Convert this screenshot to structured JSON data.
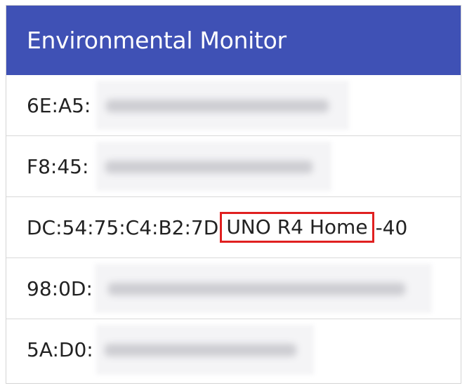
{
  "app_bar": {
    "title": "Environmental Monitor"
  },
  "devices": [
    {
      "address": "6E:A5:"
    },
    {
      "address": "F8:45:"
    },
    {
      "address": "DC:54:75:C4:B2:7D",
      "name": "UNO R4 Home",
      "rssi": "-40"
    },
    {
      "address": "98:0D:"
    },
    {
      "address": "5A:D0:"
    }
  ],
  "colors": {
    "app_bar": "#3f51b5",
    "highlight_border": "#e02020"
  }
}
